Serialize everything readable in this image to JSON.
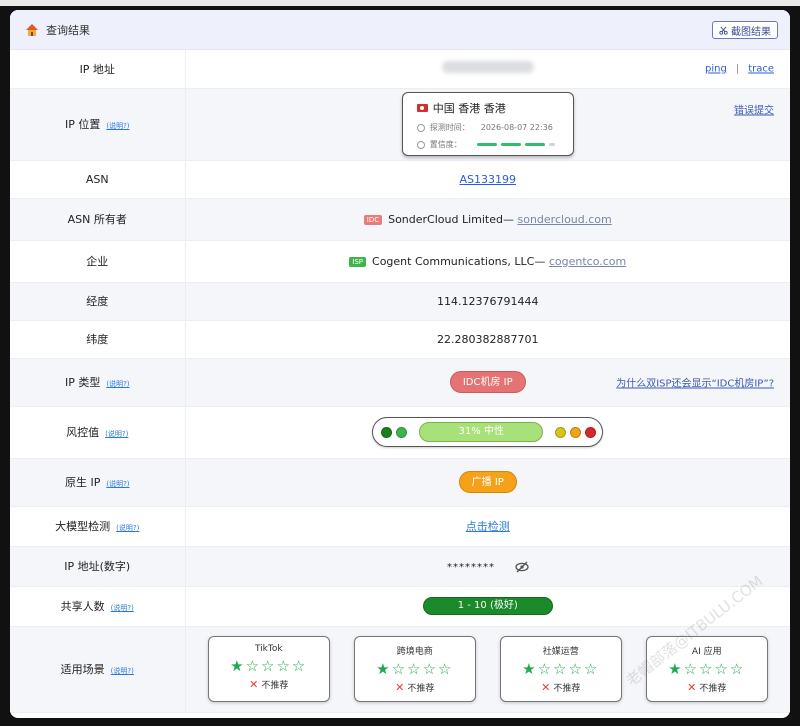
{
  "header": {
    "title": "查询结果",
    "screenshot_label": "截图结果"
  },
  "rows": {
    "ip_address": {
      "label": "IP 地址",
      "ping": "ping",
      "sep": "|",
      "trace": "trace"
    },
    "ip_location": {
      "label": "IP 位置",
      "help": "(说明?)",
      "location": "中国 香港 香港",
      "detect_label": "探测时间：",
      "detect_time": "2026-08-07 22:36",
      "confidence_label": "置信度：",
      "confidence_level": 0.75,
      "report": "错误提交"
    },
    "asn": {
      "label": "ASN",
      "value": "AS133199"
    },
    "asn_owner": {
      "label": "ASN 所有者",
      "tag": "IDC",
      "name": "SonderCloud Limited—",
      "domain": "sondercloud.com"
    },
    "enterprise": {
      "label": "企业",
      "tag": "ISP",
      "name": "Cogent Communications, LLC—",
      "domain": "cogentco.com"
    },
    "longitude": {
      "label": "经度",
      "value": "114.12376791444"
    },
    "latitude": {
      "label": "纬度",
      "value": "22.280382887701"
    },
    "ip_type": {
      "label": "IP 类型",
      "help": "(说明?)",
      "value": "IDC机房 IP",
      "question": "为什么双ISP还会显示“IDC机房IP”?"
    },
    "risk": {
      "label": "风控值",
      "help": "(说明?)",
      "value": "31%  中性",
      "colors": [
        "#1a7f1a",
        "#3cb54a",
        "#d9c21a",
        "#f0a21a",
        "#d62828"
      ]
    },
    "native_ip": {
      "label": "原生 IP",
      "help": "(说明?)",
      "value": "广播 IP"
    },
    "llm_check": {
      "label": "大模型检测",
      "help": "(说明?)",
      "value": "点击检测"
    },
    "ip_numeric": {
      "label": "IP 地址(数字)",
      "value": "********"
    },
    "shared_users": {
      "label": "共享人数",
      "help": "(说明?)",
      "value": "1 - 10 (极好)"
    },
    "scenarios": {
      "label": "适用场景",
      "help": "(说明?)",
      "items": [
        {
          "name": "TikTok",
          "stars": 1,
          "rec": "不推荐"
        },
        {
          "name": "跨境电商",
          "stars": 1,
          "rec": "不推荐"
        },
        {
          "name": "社媒运营",
          "stars": 1,
          "rec": "不推荐"
        },
        {
          "name": "AI 应用",
          "stars": 1,
          "rec": "不推荐"
        }
      ]
    }
  },
  "watermark": "老帽部落@ITBULU.COM"
}
